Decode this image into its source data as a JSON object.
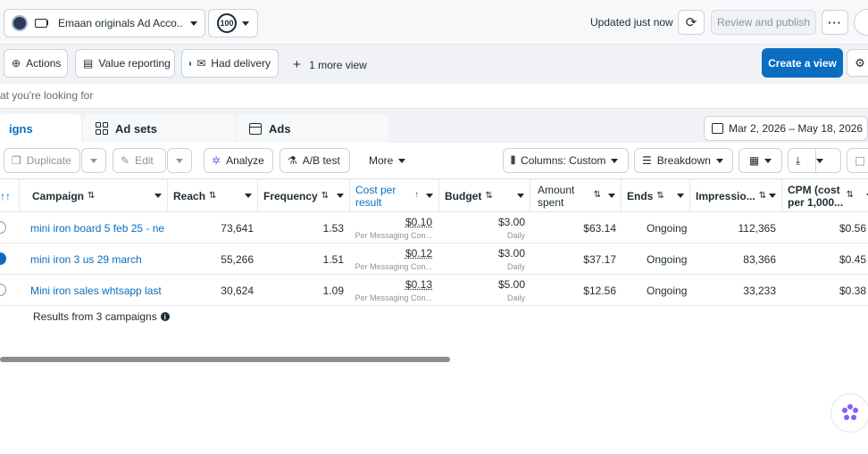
{
  "header": {
    "account_name": "Emaan originals Ad Acco...",
    "score": "100",
    "updated": "Updated just now",
    "review_publish": "Review and publish",
    "more": "···"
  },
  "filters": {
    "actions": "Actions",
    "value_reporting": "Value reporting",
    "had_delivery": "Had delivery",
    "more_view": "1 more view",
    "create_view": "Create a view"
  },
  "search": {
    "placeholder": "at you're looking for"
  },
  "tabs": {
    "campaigns": "igns",
    "ad_sets": "Ad sets",
    "ads": "Ads"
  },
  "date_range": "Mar 2, 2026 – May 18, 2026",
  "toolbar": {
    "duplicate": "Duplicate",
    "edit": "Edit",
    "analyze": "Analyze",
    "ab_test": "A/B test",
    "more": "More",
    "columns": "Columns: Custom",
    "breakdown": "Breakdown"
  },
  "table": {
    "columns": {
      "first_sort": "↑↑",
      "campaign": "Campaign",
      "reach": "Reach",
      "frequency": "Frequency",
      "cost_per_result_1": "Cost per",
      "cost_per_result_2": "result",
      "budget": "Budget",
      "amount_spent_1": "Amount",
      "amount_spent_2": "spent",
      "ends": "Ends",
      "impressions": "Impressio...",
      "cpm_1": "CPM (cost",
      "cpm_2": "per 1,000..."
    },
    "rows": [
      {
        "campaign": "mini iron board 5 feb 25 - ne...",
        "reach": "73,641",
        "frequency": "1.53",
        "cost_per_result": "$0.10",
        "cost_sub": "Per Messaging Con...",
        "budget": "$3.00",
        "budget_sub": "Daily",
        "amount_spent": "$63.14",
        "ends": "Ongoing",
        "impressions": "112,365",
        "cpm": "$0.56",
        "selected": false
      },
      {
        "campaign": "mini iron 3 us 29 march",
        "reach": "55,266",
        "frequency": "1.51",
        "cost_per_result": "$0.12",
        "cost_sub": "Per Messaging Con...",
        "budget": "$3.00",
        "budget_sub": "Daily",
        "amount_spent": "$37.17",
        "ends": "Ongoing",
        "impressions": "83,366",
        "cpm": "$0.45",
        "selected": true
      },
      {
        "campaign": "Mini iron sales whtsapp last ...",
        "reach": "30,624",
        "frequency": "1.09",
        "cost_per_result": "$0.13",
        "cost_sub": "Per Messaging Con...",
        "budget": "$5.00",
        "budget_sub": "Daily",
        "amount_spent": "$12.56",
        "ends": "Ongoing",
        "impressions": "33,233",
        "cpm": "$0.38",
        "selected": false
      }
    ],
    "results_summary": "Results from 3 campaigns"
  },
  "colors": {
    "accent": "#0a6dc2",
    "text": "#1c2b33",
    "muted": "#8a949e"
  }
}
